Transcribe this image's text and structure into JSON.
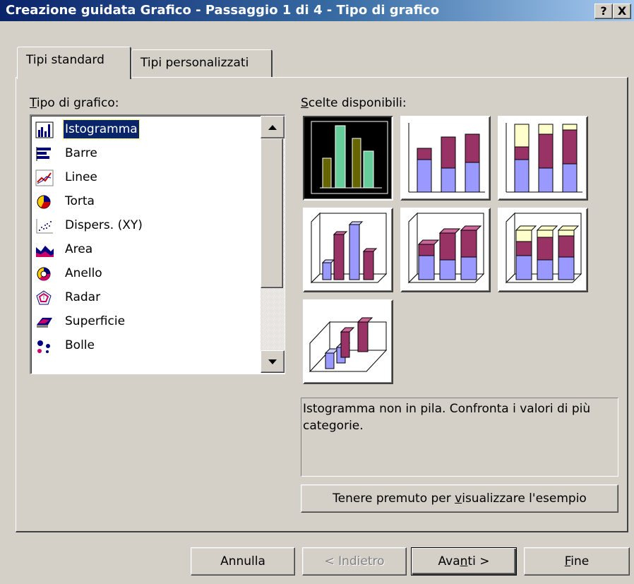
{
  "window": {
    "title": "Creazione guidata Grafico - Passaggio 1 di 4 - Tipo di grafico",
    "help_label": "?",
    "close_label": "X"
  },
  "tabs": [
    {
      "label": "Tipi standard",
      "active": true
    },
    {
      "label": "Tipi personalizzati",
      "active": false
    }
  ],
  "chart_type": {
    "label_first": "T",
    "label_rest": "ipo di grafico:",
    "items": [
      {
        "label": "Istogramma",
        "icon": "column-chart-icon",
        "selected": true
      },
      {
        "label": "Barre",
        "icon": "bar-chart-icon"
      },
      {
        "label": "Linee",
        "icon": "line-chart-icon"
      },
      {
        "label": "Torta",
        "icon": "pie-chart-icon"
      },
      {
        "label": "Dispers. (XY)",
        "icon": "scatter-chart-icon"
      },
      {
        "label": "Area",
        "icon": "area-chart-icon"
      },
      {
        "label": "Anello",
        "icon": "doughnut-chart-icon"
      },
      {
        "label": "Radar",
        "icon": "radar-chart-icon"
      },
      {
        "label": "Superficie",
        "icon": "surface-chart-icon"
      },
      {
        "label": "Bolle",
        "icon": "bubble-chart-icon"
      }
    ]
  },
  "subtypes": {
    "label_first": "S",
    "label_rest": "celte disponibili:",
    "items": [
      {
        "name": "clustered-column",
        "selected": true
      },
      {
        "name": "stacked-column"
      },
      {
        "name": "100-stacked-column"
      },
      {
        "name": "3d-clustered-column"
      },
      {
        "name": "3d-stacked-column"
      },
      {
        "name": "3d-100-stacked-column"
      },
      {
        "name": "3d-column"
      }
    ]
  },
  "description": "Istogramma non in pila. Confronta i valori di più categorie.",
  "preview_button": {
    "before": "Tenere premuto per ",
    "access": "v",
    "after": "isualizzare l'esempio"
  },
  "buttons": {
    "cancel": "Annulla",
    "back": "< Indietro",
    "next_before": "Ava",
    "next_access": "n",
    "next_after": "ti >",
    "finish_access": "F",
    "finish_rest": "ine"
  },
  "colors": {
    "title_start": "#0a246a",
    "title_end": "#a6caf0",
    "face": "#d4d0c8",
    "selection": "#0a246a",
    "bar_green": "#66cc99",
    "bar_olive": "#666600",
    "bar_blue": "#9999ff",
    "bar_maroon": "#993366",
    "bar_cream": "#ffffcc"
  }
}
